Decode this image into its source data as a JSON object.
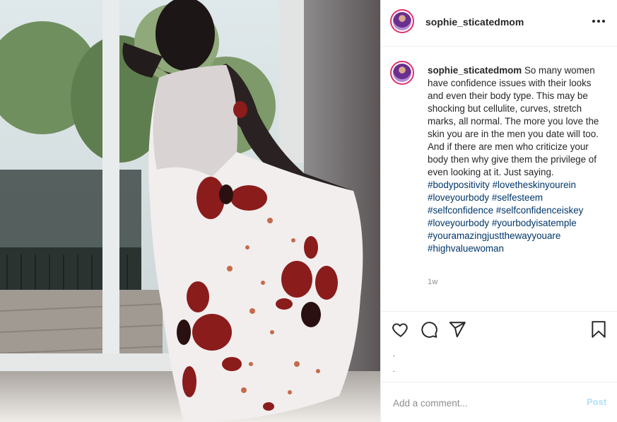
{
  "post": {
    "username": "sophie_sticatedmom",
    "caption_text": "So many women have confidence issues with their looks and even their body type. This may be shocking but cellulite, curves, stretch marks, all normal. The more you love the skin you are in the men you date will too. And if there are men who criticize your body then why give them the privilege of even looking at it. Just saying.",
    "hashtags": [
      "#bodypositivity",
      "#lovetheskinyourein",
      "#loveyourbody",
      "#selfesteem",
      "#selfconfidence",
      "#selfconfidenceiskey",
      "#loveyourbody",
      "#yourbodyisatemple",
      "#youramazingjustthewayyouare",
      "#highvaluewoman"
    ],
    "time_ago": "1w",
    "more_icon": "more-options-icon"
  },
  "actions": {
    "icons": [
      "heart-icon",
      "comment-icon",
      "share-icon",
      "bookmark-icon"
    ],
    "dot_line_1": ".",
    "dot_line_2": "."
  },
  "comment": {
    "placeholder": "Add a comment...",
    "post_label": "Post"
  },
  "colors": {
    "accent_ring": "#e1306c",
    "hashtag": "#00376b",
    "post_button_disabled": "#b2dffc",
    "muted": "#8e8e8e"
  }
}
